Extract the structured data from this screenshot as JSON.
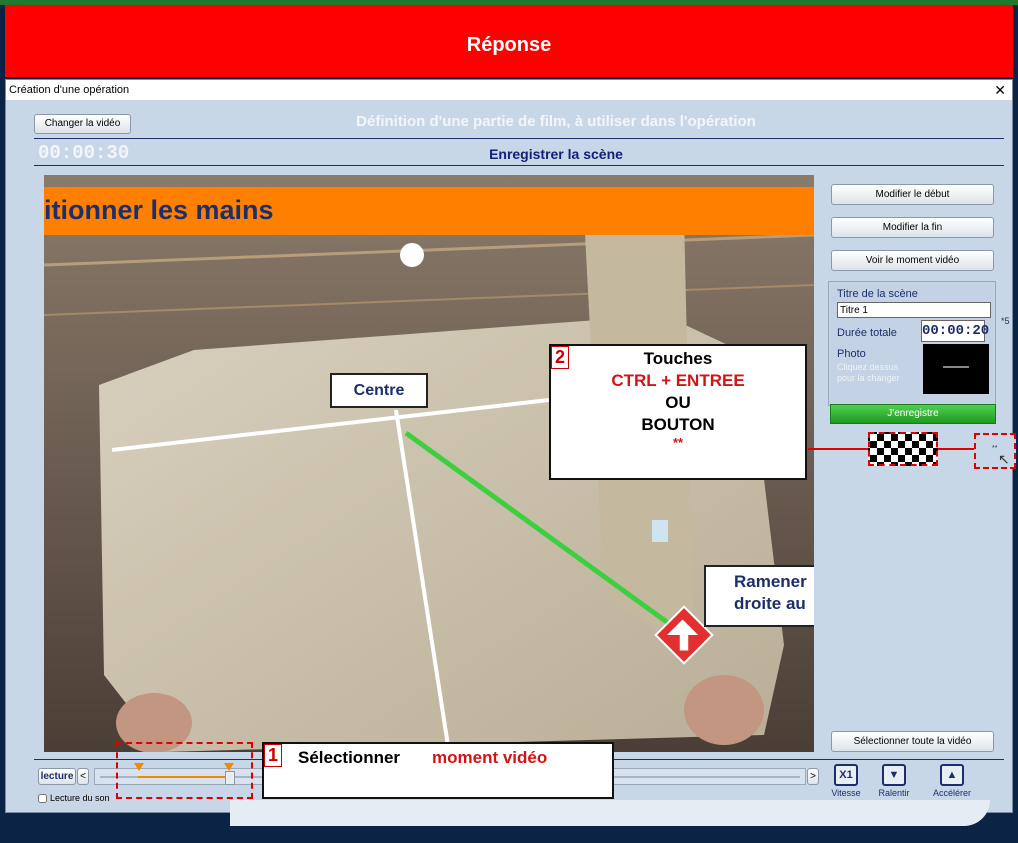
{
  "banner": {
    "title": "Réponse"
  },
  "window": {
    "title": "Création d'une opération",
    "close": "✕"
  },
  "header": {
    "change_video": "Changer la vidéo",
    "title": "Définition d'une partie de film, à utiliser dans l'opération",
    "timer": "00:00:30",
    "subtitle": "Enregistrer la scène"
  },
  "video": {
    "banner_text": "itionner les mains",
    "centre_label": "Centre",
    "hint_line1": "Ramener",
    "hint_line2": "droite au"
  },
  "side": {
    "modify_start": "Modifier le début",
    "modify_end": "Modifier la fin",
    "view_moment": "Voir le moment vidéo",
    "scene_title_label": "Titre de la scène",
    "scene_title_value": "Titre 1",
    "duration_label": "Durée totale",
    "duration_value": "00:00:20",
    "photo_label": "Photo",
    "photo_hint1": "Cliquez dessus",
    "photo_hint2": "pour la changer",
    "star_mark": "*5",
    "record": "J'enregistre",
    "select_all": "Sélectionner toute la vidéo",
    "tiny_mark": "**"
  },
  "callout2": {
    "number": "2",
    "line1": "Touches",
    "line2": "CTRL + ENTREE",
    "line3": "OU",
    "line4": "BOUTON",
    "line5": "**"
  },
  "callout1": {
    "number": "1",
    "text_black": "Sélectionner",
    "text_red": "moment vidéo"
  },
  "controls": {
    "play": "lecture",
    "prev": "<",
    "next": ">",
    "sound": "Lecture du son",
    "speed_icon": "X1",
    "speed_label": "Vitesse",
    "slow_icon": "▼",
    "slow_label": "Ralentir",
    "fast_icon": "▲",
    "fast_label": "Accélérer"
  },
  "colors": {
    "banner": "#ff0000",
    "record": "#2db82d",
    "accent_red": "#e00000",
    "navy": "#1c2e6b",
    "orange": "#ff8000"
  },
  "timeline": {
    "selection_start": 0.0,
    "selection_end": 0.15,
    "position": 0.15
  }
}
